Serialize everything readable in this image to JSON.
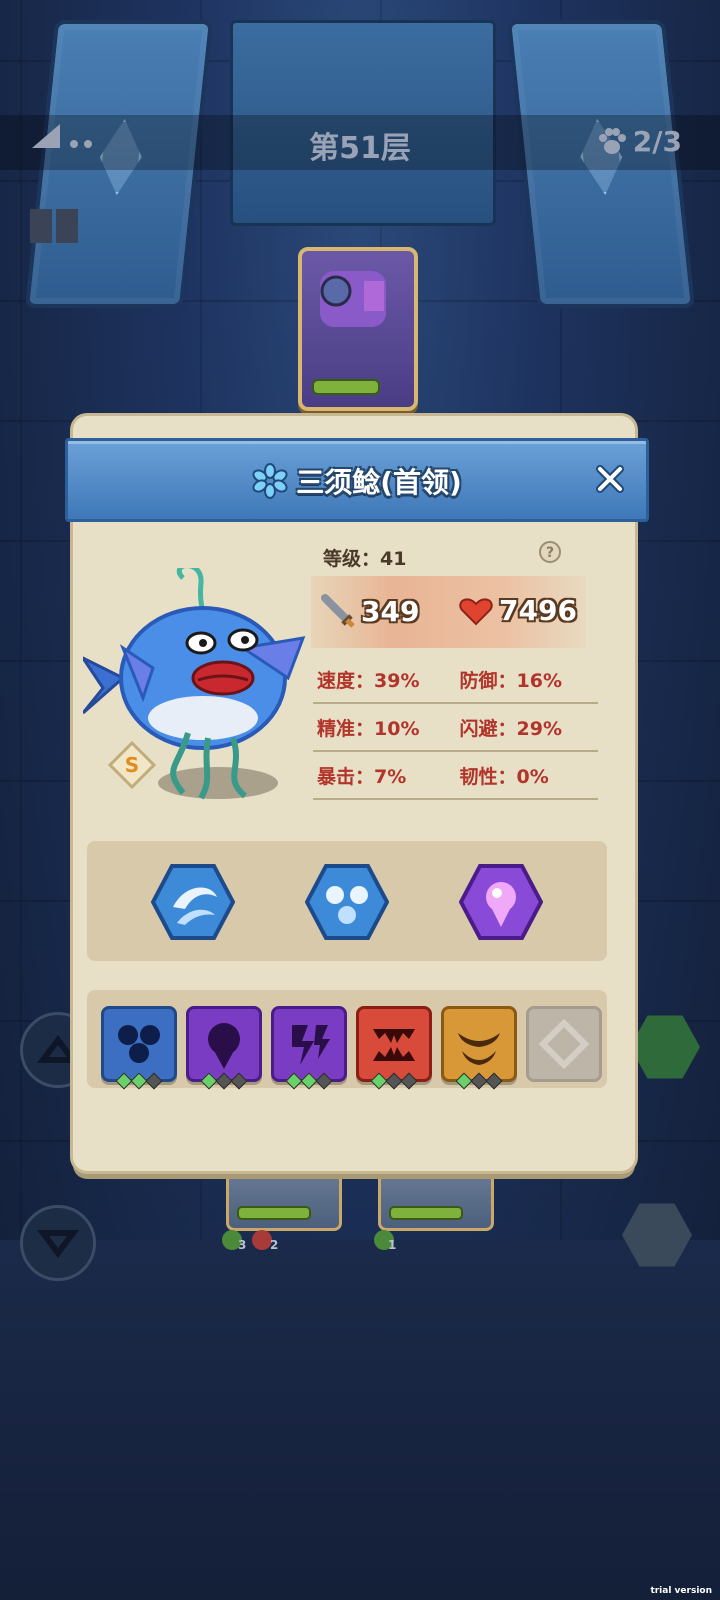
{
  "hud": {
    "floor_title": "第51层",
    "progress": "2/3"
  },
  "modal": {
    "title": "三须鲶(首领)",
    "level_label": "等级：41",
    "attack": "349",
    "hp": "7496",
    "grade": "S",
    "stats": [
      [
        "速度：39%",
        "防御：16%"
      ],
      [
        "精准：10%",
        "闪避：29%"
      ],
      [
        "暴击：7%",
        "韧性：0%"
      ]
    ],
    "skills": [
      "wave-skill-icon",
      "water-drops-skill-icon",
      "purple-drop-skill-icon"
    ],
    "buffs": [
      {
        "icon": "water-drops-icon",
        "color": "#3c6fc2",
        "dots": [
          1,
          1,
          0
        ]
      },
      {
        "icon": "purple-drop-icon",
        "color": "#7a3cc2",
        "dots": [
          1,
          0,
          0
        ]
      },
      {
        "icon": "lightning-icon",
        "color": "#7a3cc2",
        "dots": [
          1,
          1,
          0
        ]
      },
      {
        "icon": "fangs-icon",
        "color": "#d84a3a",
        "dots": [
          1,
          0,
          0
        ]
      },
      {
        "icon": "bowl-icon",
        "color": "#d89838",
        "dots": [
          1,
          0,
          0
        ]
      },
      {
        "icon": "empty-slot-icon",
        "color": "#bdb5a8",
        "dots": []
      }
    ]
  },
  "bottom": {
    "up_count": "3",
    "down_count": "2",
    "up_count2": "1"
  },
  "watermark": "trial version",
  "colors": {
    "accent": "#3f78b8",
    "stat_text": "#b1352a",
    "panel": "#e8dfc7"
  }
}
